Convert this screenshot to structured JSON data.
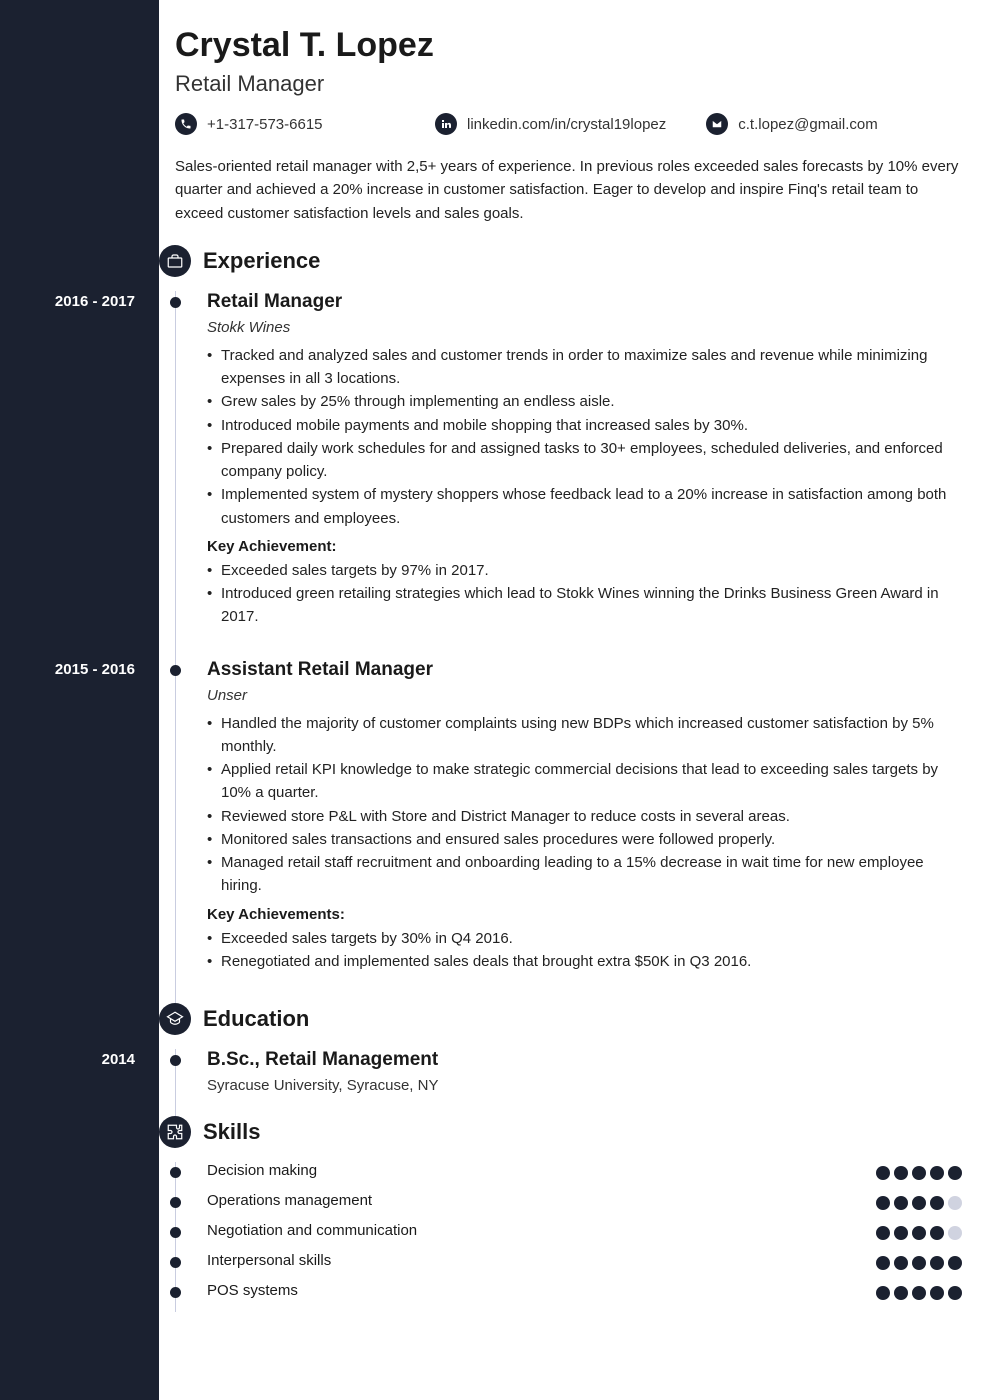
{
  "header": {
    "name": "Crystal T. Lopez",
    "title": "Retail Manager"
  },
  "contacts": {
    "phone": "+1-317-573-6615",
    "linkedin": "linkedin.com/in/crystal19lopez",
    "email": "c.t.lopez@gmail.com"
  },
  "summary": "Sales-oriented retail manager with 2,5+ years of experience. In previous roles exceeded sales forecasts by 10% every quarter and achieved a 20% increase in customer satisfaction. Eager to develop and inspire Finq's retail team to exceed customer satisfaction levels and sales goals.",
  "sections": {
    "experience": "Experience",
    "education": "Education",
    "skills": "Skills"
  },
  "experience": [
    {
      "dates": "2016 - 2017",
      "title": "Retail Manager",
      "company": "Stokk Wines",
      "bullets": [
        "Tracked and analyzed sales and customer trends in order to maximize sales and revenue while minimizing expenses in all 3 locations.",
        "Grew sales by 25% through implementing an endless aisle.",
        "Introduced mobile payments and mobile shopping that increased sales by 30%.",
        "Prepared daily work schedules for and assigned tasks to 30+ employees, scheduled deliveries, and enforced company policy.",
        "Implemented system of mystery shoppers whose feedback lead to a 20% increase in satisfaction among both customers and employees."
      ],
      "keyLabel": "Key Achievement:",
      "achievements": [
        "Exceeded sales targets by 97% in 2017.",
        "Introduced green retailing strategies which lead to Stokk Wines winning the Drinks Business Green Award in 2017."
      ]
    },
    {
      "dates": "2015 - 2016",
      "title": "Assistant Retail Manager",
      "company": "Unser",
      "bullets": [
        "Handled the majority of customer complaints using new BDPs which increased customer satisfaction by 5% monthly.",
        "Applied retail KPI knowledge to make strategic commercial decisions that lead to exceeding sales targets by 10% a quarter.",
        "Reviewed store P&L with Store and District Manager to reduce costs in several areas.",
        "Monitored sales transactions and ensured sales procedures were followed properly.",
        "Managed retail staff recruitment and onboarding leading to a 15% decrease in wait time for new employee hiring."
      ],
      "keyLabel": "Key Achievements:",
      "achievements": [
        "Exceeded sales targets by 30% in Q4 2016.",
        "Renegotiated and implemented sales deals that brought extra $50K in Q3 2016."
      ]
    }
  ],
  "education": [
    {
      "dates": "2014",
      "degree": "B.Sc., Retail Management",
      "school": "Syracuse University, Syracuse, NY"
    }
  ],
  "skills": [
    {
      "name": "Decision making",
      "rating": 5
    },
    {
      "name": "Operations management",
      "rating": 4
    },
    {
      "name": "Negotiation and communication",
      "rating": 4
    },
    {
      "name": "Interpersonal skills",
      "rating": 5
    },
    {
      "name": "POS systems",
      "rating": 5
    }
  ]
}
